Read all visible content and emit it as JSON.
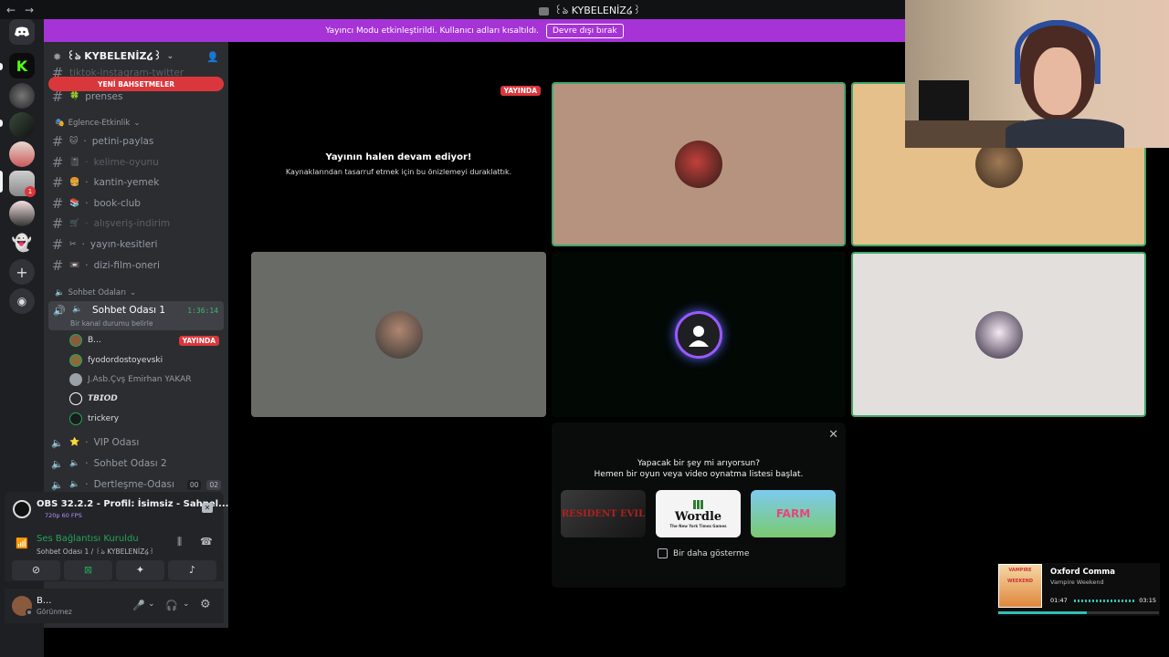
{
  "titlebar": {
    "back": "←",
    "forward": "→",
    "server_name": "꒰ঌ KYBELENİZ໒꒱"
  },
  "banner": {
    "text": "Yayıncı Modu etkinleştirildi. Kullanıcı adları kısaltıldı.",
    "button": "Devre dışı bırak"
  },
  "sidebar": {
    "server_name": "꒰ঌ KYBELENİZ໒꒱",
    "new_mentions": "YENİ BAHSETMELER",
    "cut_channel": "tiktok-instagram-twitter",
    "top_channel": "prenses",
    "category1": "Eglence-Etkinlik",
    "channels": [
      {
        "icon": "🐱",
        "name": "petini-paylas",
        "muted": false
      },
      {
        "icon": "📓",
        "name": "kelime-oyunu",
        "muted": true
      },
      {
        "icon": "🍔",
        "name": "kantin-yemek",
        "muted": false
      },
      {
        "icon": "📚",
        "name": "book-club",
        "muted": false
      },
      {
        "icon": "🛒",
        "name": "alışveriş-indirim",
        "muted": true
      },
      {
        "icon": "✂",
        "name": "yayın-kesitleri",
        "muted": false
      },
      {
        "icon": "📼",
        "name": "dizi-film-oneri",
        "muted": false
      }
    ],
    "category2": "Sohbet Odaları",
    "active_voice": {
      "name": "Sohbet Odası 1",
      "timer": "1:36:14",
      "status": "Bir kanal durumu belirle"
    },
    "voice_users": [
      {
        "name": "B...",
        "live": "YAYINDA",
        "color": "#8a5a3c"
      },
      {
        "name": "fyodordostoyevski",
        "live": "",
        "color": "#8b6b3a"
      },
      {
        "name": "J.Asb.Çvş Emirhan YAKAR",
        "live": "",
        "color": "#9aa1a8"
      },
      {
        "name": "𝙏𝘽𝙄𝙊𝘿",
        "live": "",
        "color": "#ffffff"
      },
      {
        "name": "trickery",
        "live": "",
        "color": "#1b1b1b"
      }
    ],
    "other_voice": [
      {
        "emoji": "⭐",
        "name": "VIP Odası"
      },
      {
        "emoji": "🔈",
        "name": "Sohbet Odası 2"
      },
      {
        "emoji": "🔈",
        "name": "Dertleşme-Odası",
        "count_a": "00",
        "count_b": "02"
      }
    ]
  },
  "stream_panel": {
    "title": "OBS 32.2.2 - Profil: İsimsiz - Sahnel...",
    "quality": "720p 60 FPS"
  },
  "voice_panel": {
    "status": "Ses Bağlantısı Kuruldu",
    "channel": "Sohbet Odası 1 / ꒰ঌ KYBELENİZ໒꒱"
  },
  "user_panel": {
    "name": "B...",
    "status": "Görünmez"
  },
  "main": {
    "live_badge": "YAYINDA",
    "paused_title": "Yayının halen devam ediyor!",
    "paused_sub": "Kaynaklarından tasarruf etmek için bu önizlemeyi duraklattık."
  },
  "activity": {
    "line1": "Yapacak bir şey mi arıyorsun?",
    "line2": "Hemen bir oyun veya video oynatma listesi başlat.",
    "games": [
      "RESIDENT EVIL",
      "Wordle",
      "FARM"
    ],
    "wordle_sub": "The New York Times Games",
    "checkbox_label": "Bir daha gösterme"
  },
  "music": {
    "title": "Oxford Comma",
    "artist": "Vampire Weekend",
    "elapsed": "01:47",
    "total": "03:15",
    "progress": 0.55,
    "album_text": "VAMPIRE WEEKEND"
  },
  "colors": {
    "accent": "#5865f2",
    "banner": "#a633d6",
    "live": "#da373c",
    "speaking": "#3fa86a"
  }
}
